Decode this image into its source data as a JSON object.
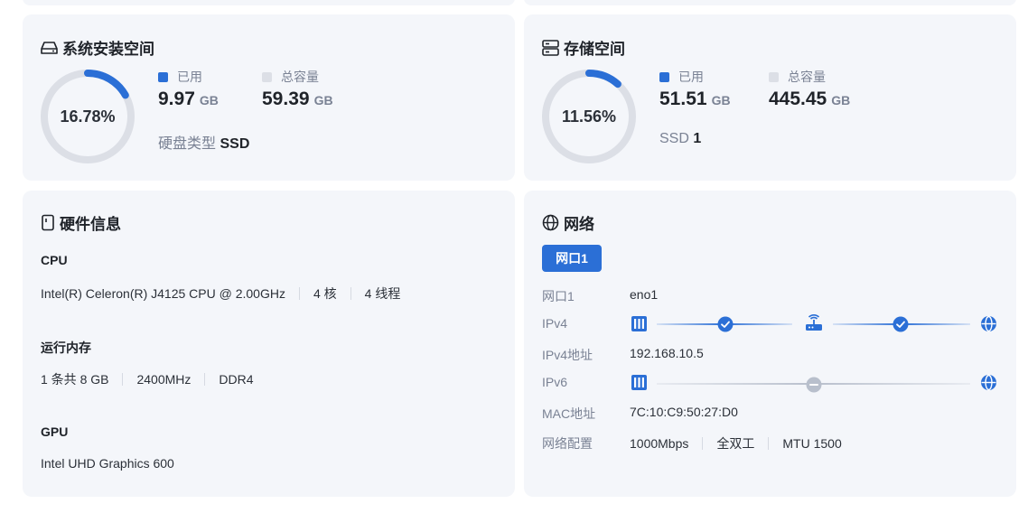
{
  "system_space": {
    "title": "系统安装空间",
    "percent_label": "16.78%",
    "percent": 16.78,
    "used_label": "已用",
    "total_label": "总容量",
    "used_value": "9.97",
    "used_unit": "GB",
    "total_value": "59.39",
    "total_unit": "GB",
    "disk_type_label": "硬盘类型",
    "disk_type_value": "SSD"
  },
  "storage_space": {
    "title": "存储空间",
    "percent_label": "11.56%",
    "percent": 11.56,
    "used_label": "已用",
    "total_label": "总容量",
    "used_value": "51.51",
    "used_unit": "GB",
    "total_value": "445.45",
    "total_unit": "GB",
    "disk_label": "SSD",
    "disk_count": "1"
  },
  "hardware": {
    "title": "硬件信息",
    "cpu_heading": "CPU",
    "cpu_model": "Intel(R) Celeron(R) J4125 CPU @ 2.00GHz",
    "cpu_cores": "4 核",
    "cpu_threads": "4 线程",
    "memory_heading": "运行内存",
    "memory_count": "1 条共 8 GB",
    "memory_speed": "2400MHz",
    "memory_type": "DDR4",
    "gpu_heading": "GPU",
    "gpu_model": "Intel UHD Graphics 600"
  },
  "network": {
    "title": "网络",
    "tab_label": "网口1",
    "rows": {
      "port_label": "网口1",
      "port_value": "eno1",
      "ipv4_label": "IPv4",
      "ipv4_addr_label": "IPv4地址",
      "ipv4_addr_value": "192.168.10.5",
      "ipv6_label": "IPv6",
      "mac_label": "MAC地址",
      "mac_value": "7C:10:C9:50:27:D0",
      "config_label": "网络配置",
      "config_speed": "1000Mbps",
      "config_duplex": "全双工",
      "config_mtu": "MTU 1500"
    }
  },
  "colors": {
    "accent": "#2b6fd6",
    "ring_track": "#dcdfe6",
    "card_bg": "#f4f6fa",
    "muted": "#7a8294",
    "disabled": "#b8bfcc"
  }
}
